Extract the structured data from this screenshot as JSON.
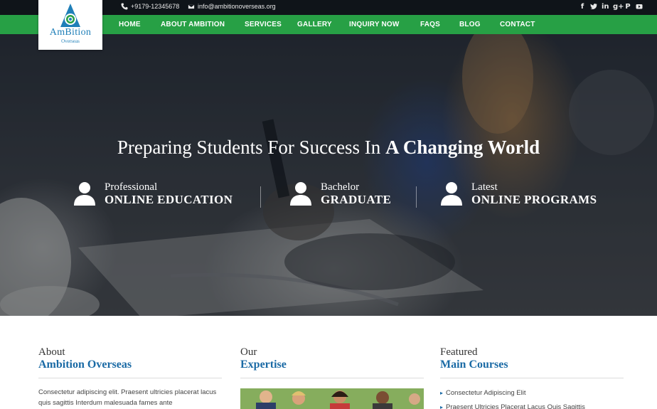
{
  "topbar": {
    "phone": "+9179-12345678",
    "email": "info@ambitionoverseas.org",
    "social_icons": [
      "facebook-icon",
      "twitter-icon",
      "linkedin-icon",
      "google-plus-icon",
      "pinterest-icon",
      "youtube-icon"
    ]
  },
  "logo": {
    "name": "AmBition",
    "sub": "Overseas"
  },
  "nav": {
    "items": [
      "HOME",
      "ABOUT AMBITION",
      "SERVICES",
      "GALLERY",
      "INQUIRY NOW",
      "FAQS",
      "BLOG",
      "CONTACT"
    ]
  },
  "hero": {
    "title_part1": "Preparing Students For Success In ",
    "title_part2": "A Changing World",
    "features": [
      {
        "small": "Professional",
        "big": "ONLINE EDUCATION"
      },
      {
        "small": "Bachelor",
        "big": "GRADUATE"
      },
      {
        "small": "Latest",
        "big": "ONLINE PROGRAMS"
      }
    ]
  },
  "sections": {
    "about": {
      "top": "About",
      "bottom": "Ambition Overseas",
      "text": "Consectetur adipiscing elit. Praesent ultricies placerat lacus quis sagittis Interdum malesuada fames ante"
    },
    "expertise": {
      "top": "Our",
      "bottom": "Expertise"
    },
    "courses": {
      "top": "Featured",
      "bottom": "Main Courses",
      "items": [
        "Consectetur Adipiscing Elit",
        "Praesent Ultricies Placerat Lacus Quis Sagittis"
      ]
    }
  },
  "colors": {
    "nav_green": "#27a045",
    "topbar_dark": "#0f1419",
    "heading_blue": "#1a6aa5",
    "logo_blue": "#1f7fb8"
  }
}
